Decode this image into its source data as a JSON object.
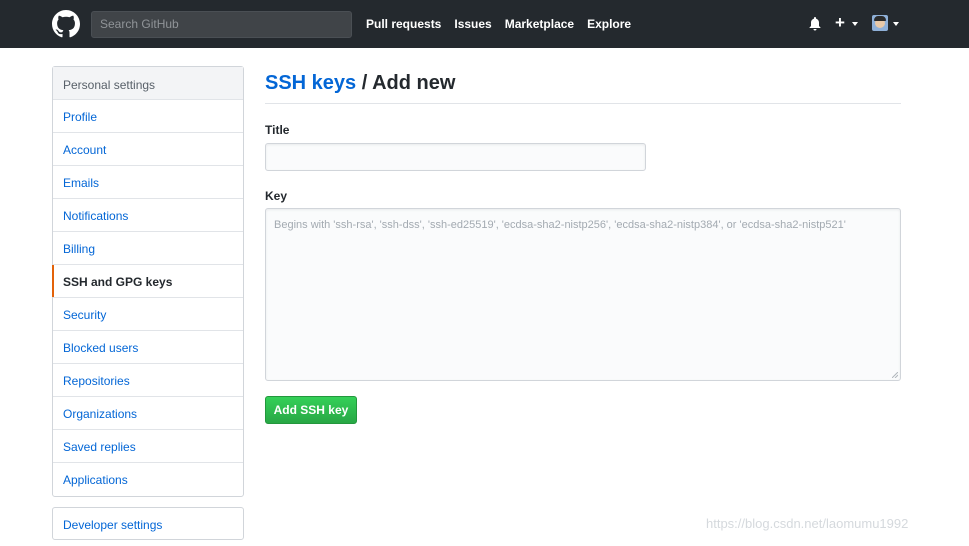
{
  "header": {
    "search_placeholder": "Search GitHub",
    "nav": [
      "Pull requests",
      "Issues",
      "Marketplace",
      "Explore"
    ],
    "plus": "+",
    "icons": {
      "logo": "github-octocat-icon",
      "notifications": "bell-icon",
      "new": "plus-icon",
      "avatar": "user-avatar"
    }
  },
  "sidebar": {
    "heading": "Personal settings",
    "items": [
      {
        "label": "Profile"
      },
      {
        "label": "Account"
      },
      {
        "label": "Emails"
      },
      {
        "label": "Notifications"
      },
      {
        "label": "Billing"
      },
      {
        "label": "SSH and GPG keys",
        "selected": true
      },
      {
        "label": "Security"
      },
      {
        "label": "Blocked users"
      },
      {
        "label": "Repositories"
      },
      {
        "label": "Organizations"
      },
      {
        "label": "Saved replies"
      },
      {
        "label": "Applications"
      }
    ],
    "developer_settings": "Developer settings"
  },
  "main": {
    "breadcrumb_link": "SSH keys",
    "breadcrumb_rest": " / Add new",
    "title_label": "Title",
    "title_value": "",
    "key_label": "Key",
    "key_value": "",
    "key_placeholder": "Begins with 'ssh-rsa', 'ssh-dss', 'ssh-ed25519', 'ecdsa-sha2-nistp256', 'ecdsa-sha2-nistp384', or 'ecdsa-sha2-nistp521'",
    "submit_label": "Add SSH key"
  },
  "watermark": "https://blog.csdn.net/laomumu1992",
  "colors": {
    "header_bg": "#24292e",
    "link": "#0366d6",
    "selected_marker": "#e36209",
    "button_green": "#28a745"
  }
}
